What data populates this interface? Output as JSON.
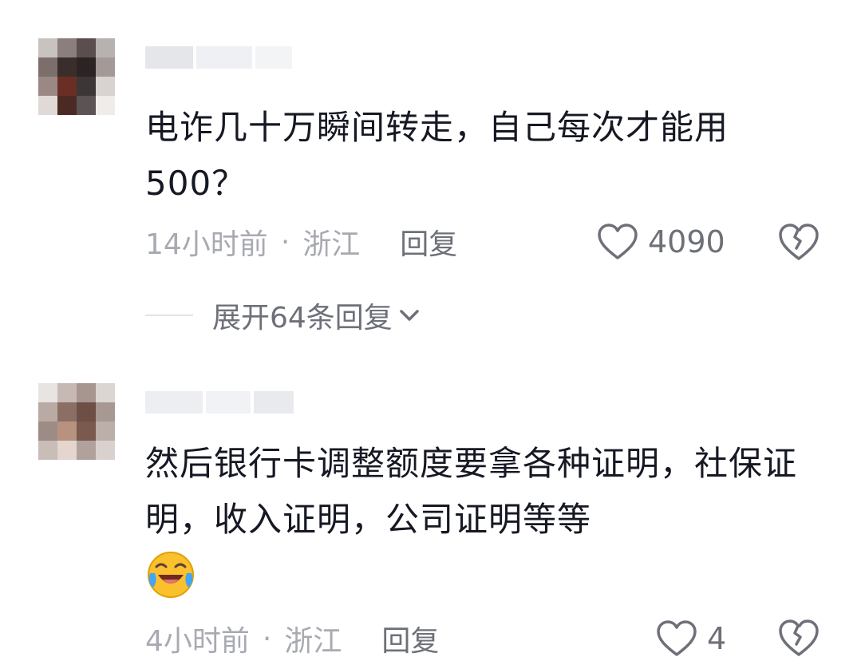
{
  "comments": [
    {
      "username": "",
      "text": "电诈几十万瞬间转走，自己每次才能用500？",
      "time": "14小时前",
      "separator": "·",
      "location": "浙江",
      "reply_label": "回复",
      "likes": "4090",
      "expand_label": "展开64条回复"
    },
    {
      "username": "",
      "text": "然后银行卡调整额度要拿各种证明，社保证明，收入证明，公司证明等等",
      "emoji": "laughing-with-tears-emoji",
      "time": "4小时前",
      "separator": "·",
      "location": "浙江",
      "reply_label": "回复",
      "likes": "4"
    }
  ],
  "colors": {
    "text_primary": "#161823",
    "text_meta": "#a8aab2",
    "text_action": "#6e7079",
    "icon": "#6e7079"
  }
}
